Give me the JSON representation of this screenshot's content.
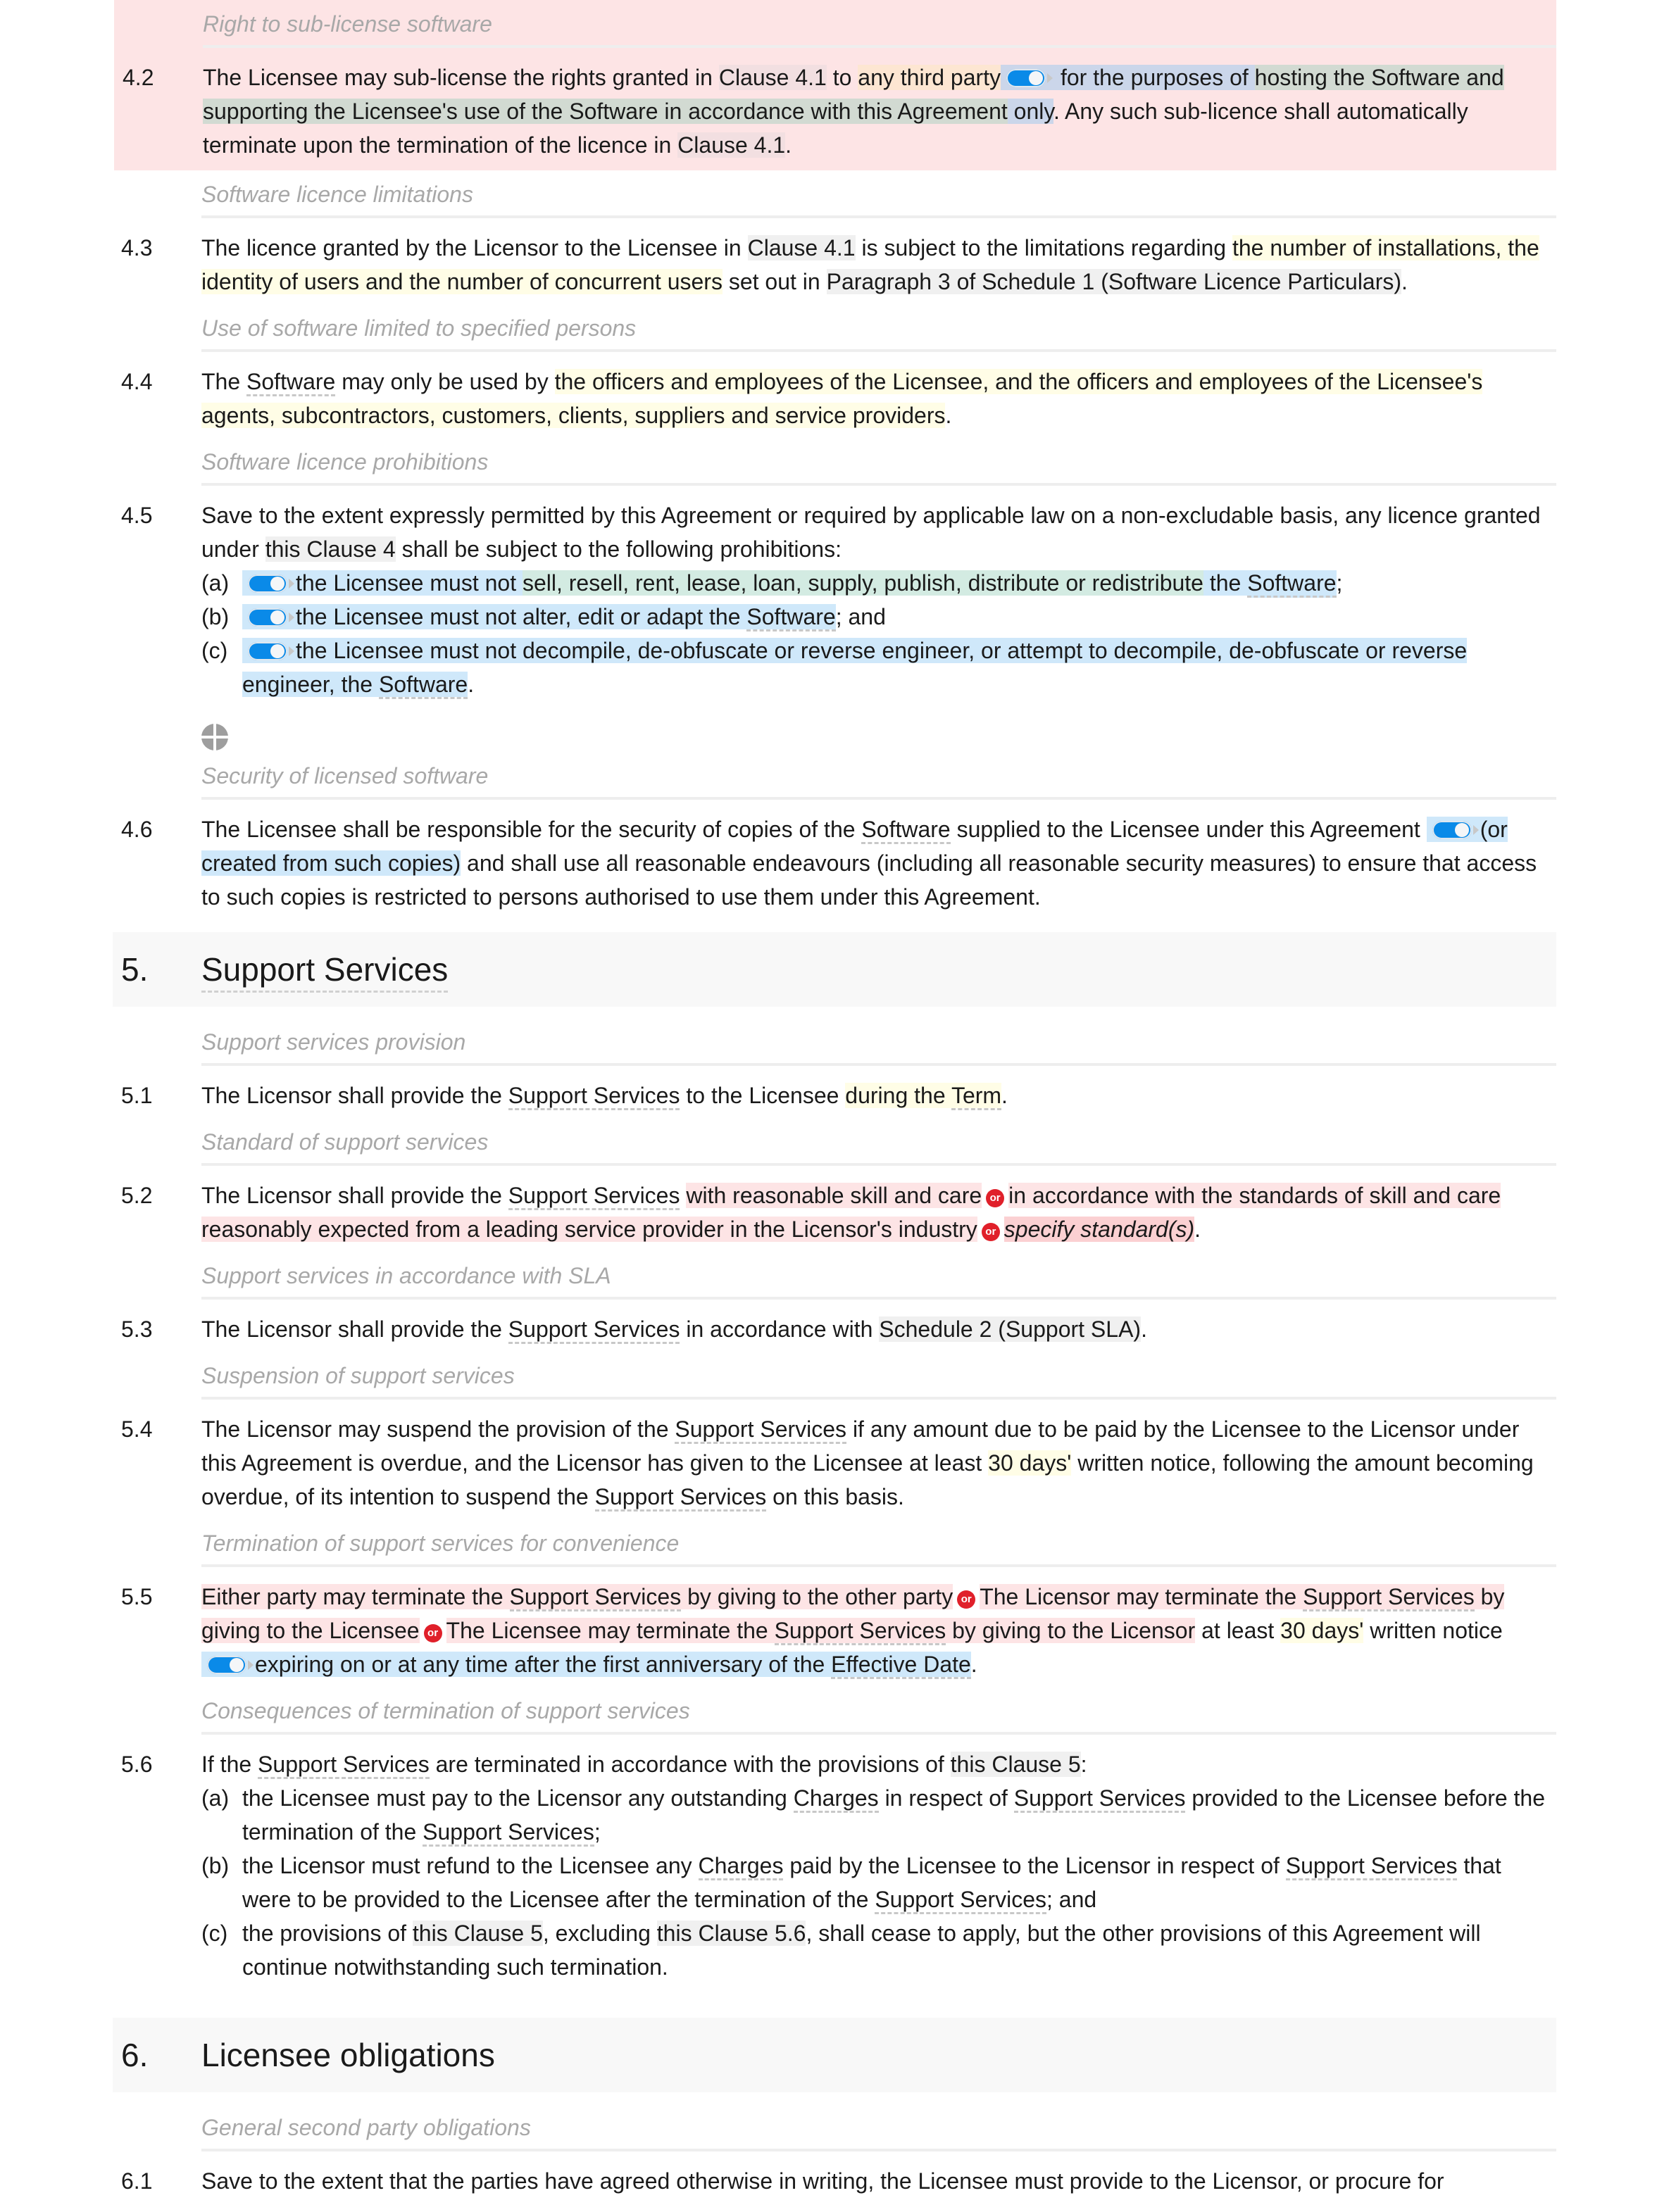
{
  "section4": {
    "c42": {
      "subheading": "Right to sub-license software",
      "num": "4.2",
      "t1": "The Licensee may sub-license the rights granted in ",
      "ref1": "Clause 4.1",
      "t2": " to ",
      "opt1": "any third party",
      "opt2": " for the purposes of ",
      "opt3a": "hosting the Software and supporting the Licensee's use of the Software in accordance with this Agreement",
      "opt3b": " only",
      "t3": ". Any such sub-licence shall automatically terminate upon the termination of the licence in ",
      "ref2": "Clause 4.1",
      "t4": "."
    },
    "c43": {
      "subheading": "Software licence limitations",
      "num": "4.3",
      "t1": "The licence granted by the Licensor to the Licensee in ",
      "ref1": "Clause 4.1",
      "t2": " is subject to the limitations regarding ",
      "yel": "the number of installations, the identity of users and the number of concurrent users",
      "t3": " set out in ",
      "ref2": "Paragraph 3 of Schedule 1 (Software Licence Particulars)",
      "t4": "."
    },
    "c44": {
      "subheading": "Use of software limited to specified persons",
      "num": "4.4",
      "t1": "The ",
      "term": "Software",
      "t2": " may only be used by ",
      "yel": "the officers and employees of the Licensee, and the officers and employees of the Licensee's agents, subcontractors, customers, clients, suppliers and service providers",
      "t3": "."
    },
    "c45": {
      "subheading": "Software licence prohibitions",
      "num": "4.5",
      "t1": "Save to the extent expressly permitted by this Agreement or required by applicable law on a non-excludable basis, any licence granted under ",
      "ref1": "this Clause 4",
      "t2": " shall be subject to the following prohibitions:",
      "items": [
        {
          "label": "(a)",
          "a": "the Licensee must not ",
          "b": "sell, resell, rent, lease, loan, supply, publish, distribute or redistribute",
          "c": " the ",
          "term": "Software",
          "end": ";"
        },
        {
          "label": "(b)",
          "a": "the Licensee must not alter, edit or adapt the ",
          "term": "Software",
          "end": "; and"
        },
        {
          "label": "(c)",
          "a": "the Licensee must not decompile, de-obfuscate or reverse engineer, or attempt to decompile, de-obfuscate or reverse engineer, the ",
          "term": "Software",
          "end": "."
        }
      ]
    },
    "c46": {
      "subheading": "Security of licensed software",
      "num": "4.6",
      "t1": "The Licensee shall be responsible for the security of copies of the ",
      "term": "Software",
      "t2": " supplied to the Licensee under this Agreement ",
      "opt": "(or created from such copies)",
      "t3": " and shall use all reasonable endeavours (including all reasonable security measures) to ensure that access to such copies is restricted to persons authorised to use them under this Agreement."
    }
  },
  "section5": {
    "num": "5.",
    "title": "Support Services",
    "c51": {
      "subheading": "Support services provision",
      "num": "5.1",
      "t1": "The Licensor shall provide the ",
      "term": "Support Services",
      "t2": " to the Licensee ",
      "yel1": "during the ",
      "yelterm": "Term",
      "t3": "."
    },
    "c52": {
      "subheading": "Standard of support services",
      "num": "5.2",
      "t1": "The Licensor shall provide the ",
      "term": "Support Services",
      "t2": " ",
      "alt1": "with reasonable skill and care",
      "alt2": "in accordance with the standards of skill and care reasonably expected from a leading service provider in the Licensor's industry",
      "alt3": "specify standard(s)",
      "or": "or",
      "t3": "."
    },
    "c53": {
      "subheading": "Support services in accordance with SLA",
      "num": "5.3",
      "t1": "The Licensor shall provide the ",
      "term": "Support Services",
      "t2": " in accordance with ",
      "ref": "Schedule 2 (Support SLA)",
      "t3": "."
    },
    "c54": {
      "subheading": "Suspension of support services",
      "num": "5.4",
      "t1": "The Licensor may suspend the provision of the ",
      "term1": "Support Services",
      "t2": " if any amount due to be paid by the Licensee to the Licensor under this Agreement is overdue, and the Licensor has given to the Licensee at least ",
      "yel": "30 days'",
      "t3": " written notice, following the amount becoming overdue, of its intention to suspend the ",
      "term2": "Support Services",
      "t4": " on this basis."
    },
    "c55": {
      "subheading": "Termination of support services for convenience",
      "num": "5.5",
      "alt1a": "Either party may terminate the ",
      "alt1term": "Support Services",
      "alt1b": " by giving to the other party",
      "alt2a": "The Licensor may terminate the ",
      "alt2term": "Support Services",
      "alt2b": " by giving to the Licensee",
      "alt3a": "The Licensee may terminate the ",
      "alt3term": "Support Services",
      "alt3b": " by giving to the Licensor",
      "or": "or",
      "t1": " at least ",
      "yel": "30 days'",
      "t2": " written notice",
      "opta": "expiring on or at any time after the first anniversary of the ",
      "optterm": "Effective Date",
      "t3": "."
    },
    "c56": {
      "subheading": "Consequences of termination of support services",
      "num": "5.6",
      "t1": "If the ",
      "term": "Support Services",
      "t2": " are terminated in accordance with the provisions of ",
      "ref": "this Clause 5",
      "t3": ":",
      "a": {
        "label": "(a)",
        "t1": "the Licensee must pay to the Licensor any outstanding ",
        "term1": "Charges",
        "t2": " in respect of ",
        "term2": "Support Services",
        "t3": " provided to the Licensee before the termination of the ",
        "term3": "Support Services",
        "t4": ";"
      },
      "b": {
        "label": "(b)",
        "t1": "the Licensor must refund to the Licensee any ",
        "term1": "Charges",
        "t2": " paid by the Licensee to the Licensor in respect of ",
        "term2": "Support Services",
        "t3": " that were to be provided to the Licensee after the termination of the ",
        "term3": "Support Services",
        "t4": "; and"
      },
      "c": {
        "label": "(c)",
        "t1": "the provisions of ",
        "ref1": "this Clause 5",
        "t2": ", excluding ",
        "ref2": "this Clause 5.6",
        "t3": ", shall cease to apply, but the other provisions of this Agreement will continue notwithstanding such termination."
      }
    }
  },
  "section6": {
    "num": "6.",
    "title": "Licensee obligations",
    "c61": {
      "subheading": "General second party obligations",
      "num": "6.1",
      "t1": "Save to the extent that the parties have agreed otherwise in writing, the Licensee must provide to the Licensor, or procure for"
    }
  }
}
